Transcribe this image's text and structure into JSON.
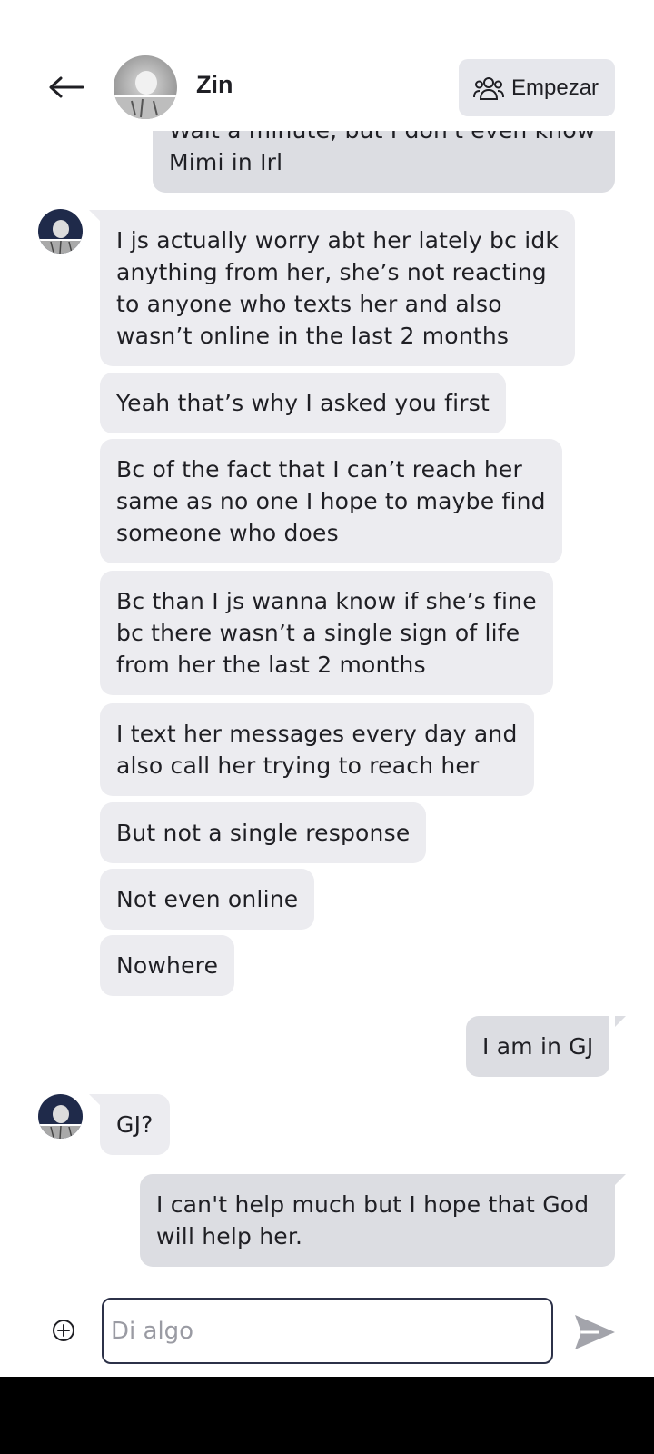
{
  "header": {
    "contact_name": "Zin",
    "start_label": "Empezar",
    "icons": {
      "back": "arrow-left-icon",
      "start": "group-users-icon",
      "avatar": "profile-photo"
    }
  },
  "messages": [
    {
      "side": "out",
      "text": "Wait a minute, but I don't even know\nMimi in Irl"
    },
    {
      "side": "in",
      "text": "I js actually worry abt her lately bc idk\nanything from her, she’s not reacting\nto anyone who texts her and also\nwasn’t online in the last 2 months"
    },
    {
      "side": "in",
      "text": "Yeah that’s why I asked you first"
    },
    {
      "side": "in",
      "text": "Bc of the fact that I can’t reach her\nsame as no one I hope to maybe find\nsomeone who does"
    },
    {
      "side": "in",
      "text": "Bc than I js wanna know if she’s fine\nbc there wasn’t a single sign of life\nfrom her the last 2 months"
    },
    {
      "side": "in",
      "text": "I text her messages every day and\nalso call her trying to reach her"
    },
    {
      "side": "in",
      "text": "But not a single response"
    },
    {
      "side": "in",
      "text": "Not even online"
    },
    {
      "side": "in",
      "text": "Nowhere"
    },
    {
      "side": "out",
      "text": "I am in GJ"
    },
    {
      "side": "in",
      "text": "GJ?"
    },
    {
      "side": "out",
      "text": "I can't help much but I hope that God\nwill help her."
    }
  ],
  "composer": {
    "placeholder": "Di algo",
    "value": "",
    "icons": {
      "attach": "plus-circle-icon",
      "send": "send-icon"
    }
  },
  "colors": {
    "incoming_bubble": "#ececf0",
    "outgoing_bubble": "#dcdde2",
    "start_button_bg": "#e6e7ec",
    "input_border": "#2c3148",
    "text": "#1f1f24",
    "nav_bar": "#000000"
  }
}
